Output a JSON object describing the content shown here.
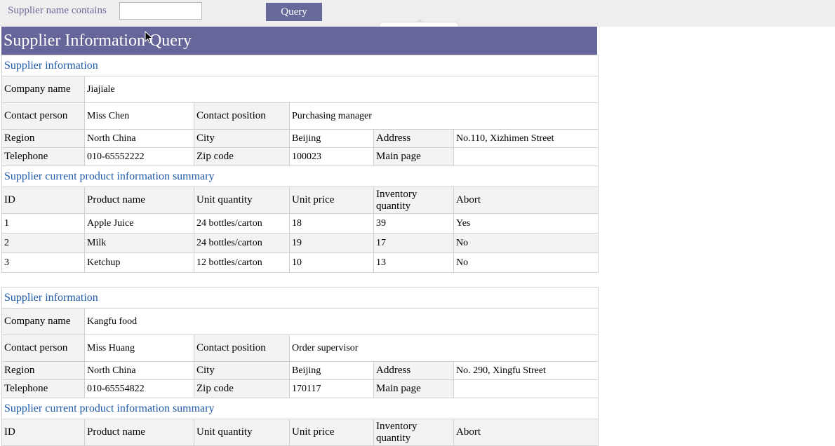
{
  "search": {
    "label": "Supplier name contains",
    "value": "",
    "placeholder": "",
    "query_button": "Query"
  },
  "page_title": "Supplier Information Query",
  "suppliers": [
    {
      "section_info": "Supplier information",
      "labels": {
        "company": "Company name",
        "contact": "Contact person",
        "position": "Contact position",
        "region": "Region",
        "city": "City",
        "address": "Address",
        "telephone": "Telephone",
        "zip": "Zip code",
        "mainpage": "Main page"
      },
      "company": "Jiajiale",
      "contact": "Miss Chen",
      "position": "Purchasing manager",
      "region": "North China",
      "city": "Beijing",
      "address": "No.110, Xizhimen Street",
      "telephone": "010-65552222",
      "zip": "100023",
      "mainpage": "",
      "section_products": "Supplier current product information summary",
      "product_headers": [
        "ID",
        "Product name",
        "Unit quantity",
        "Unit price",
        "Inventory quantity",
        "Abort"
      ],
      "products": [
        [
          "1",
          "Apple Juice",
          "24 bottles/carton",
          "18",
          "39",
          "Yes"
        ],
        [
          "2",
          "Milk",
          "24 bottles/carton",
          "19",
          "17",
          "No"
        ],
        [
          "3",
          "Ketchup",
          "12 bottles/carton",
          "10",
          "13",
          "No"
        ]
      ]
    },
    {
      "section_info": "Supplier information",
      "labels": {
        "company": "Company name",
        "contact": "Contact person",
        "position": "Contact position",
        "region": "Region",
        "city": "City",
        "address": "Address",
        "telephone": "Telephone",
        "zip": "Zip code",
        "mainpage": "Main page"
      },
      "company": "Kangfu food",
      "contact": "Miss Huang",
      "position": "Order supervisor",
      "region": "North China",
      "city": "Beijing",
      "address": "No. 290, Xingfu Street",
      "telephone": "010-65554822",
      "zip": "170117",
      "mainpage": "",
      "section_products": "Supplier current product information summary",
      "product_headers": [
        "ID",
        "Product name",
        "Unit quantity",
        "Unit price",
        "Inventory quantity",
        "Abort"
      ],
      "products": []
    }
  ]
}
